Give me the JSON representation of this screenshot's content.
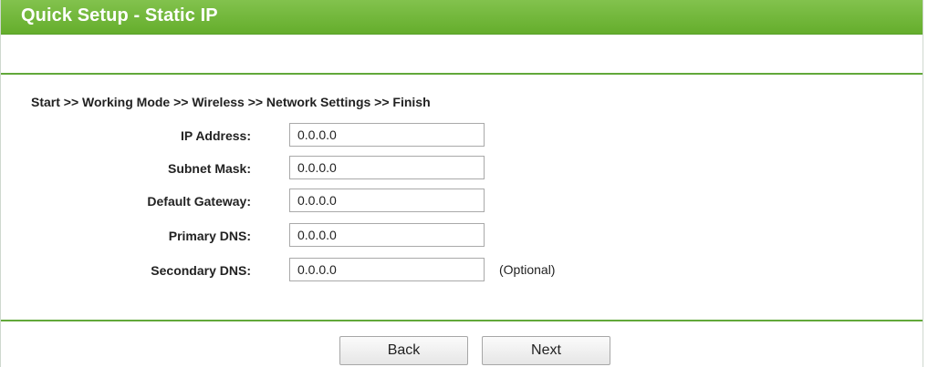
{
  "header": {
    "title": "Quick Setup - Static IP"
  },
  "breadcrumb": "Start >> Working Mode >> Wireless >> Network Settings >> Finish",
  "form": {
    "fields": [
      {
        "label": "IP Address:",
        "value": "0.0.0.0"
      },
      {
        "label": "Subnet Mask:",
        "value": "0.0.0.0"
      },
      {
        "label": "Default Gateway:",
        "value": "0.0.0.0"
      },
      {
        "label": "Primary DNS:",
        "value": "0.0.0.0"
      },
      {
        "label": "Secondary DNS:",
        "value": "0.0.0.0",
        "note": "(Optional)"
      }
    ]
  },
  "buttons": {
    "back": "Back",
    "next": "Next"
  },
  "colors": {
    "title_bar": "#6db43a",
    "divider": "#62a83a"
  }
}
